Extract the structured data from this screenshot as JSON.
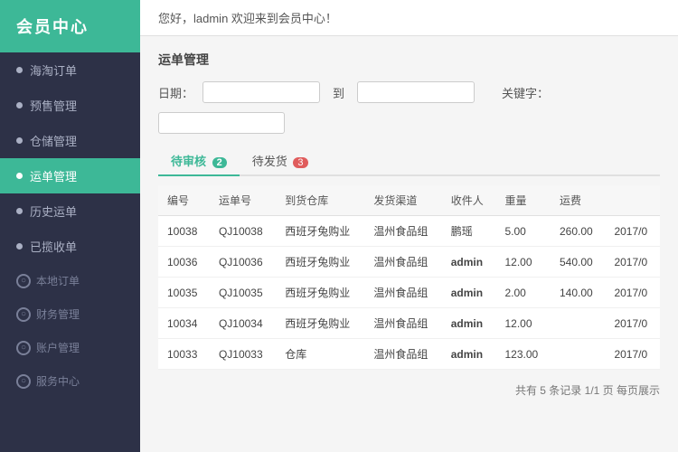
{
  "sidebar": {
    "logo": "会员中心",
    "items": [
      {
        "id": "haiwai-order",
        "label": "海淘订单",
        "active": false,
        "group": false
      },
      {
        "id": "yunshu",
        "label": "预售管理",
        "active": false,
        "group": false
      },
      {
        "id": "cangku",
        "label": "仓储管理",
        "active": false,
        "group": false
      },
      {
        "id": "yundan",
        "label": "运单管理",
        "active": true,
        "group": false
      },
      {
        "id": "lidanorder",
        "label": "历史运单",
        "active": false,
        "group": false
      },
      {
        "id": "yijiu",
        "label": "已揽收单",
        "active": false,
        "group": false
      },
      {
        "id": "bendi-order",
        "label": "本地订单",
        "active": false,
        "group": true,
        "groupLabel": "本地订单"
      },
      {
        "id": "caiwu",
        "label": "财务管理",
        "active": false,
        "group": true,
        "groupLabel": "财务管理"
      },
      {
        "id": "zhanghu",
        "label": "账户管理",
        "active": false,
        "group": true,
        "groupLabel": "账户管理"
      },
      {
        "id": "fuwu",
        "label": "服务中心",
        "active": false,
        "group": true,
        "groupLabel": "服务中心"
      }
    ]
  },
  "topbar": {
    "greeting": "您好，ladmin 欢迎来到会员中心！"
  },
  "content": {
    "section_title": "运单管理",
    "filter": {
      "date_label": "日期：",
      "date_from": "",
      "date_to_label": "到",
      "date_to": "",
      "keyword_label": "关键字：",
      "keyword_value": ""
    },
    "tabs": [
      {
        "id": "tab-pending",
        "label": "待审核",
        "count": "2",
        "active": true,
        "color": "green"
      },
      {
        "id": "tab-sending",
        "label": "待发货",
        "count": "3",
        "active": false,
        "color": "red"
      }
    ],
    "table": {
      "headers": [
        "编号",
        "运单号",
        "到货仓库",
        "发货渠道",
        "收件人",
        "重量",
        "运费",
        ""
      ],
      "rows": [
        {
          "id": "10038",
          "waybill": "QJ10038",
          "warehouse": "西班牙兔购业",
          "channel": "温州食品组",
          "receiver": "鹏瑶",
          "weight": "5.00",
          "freight": "260.00",
          "date": "2017/0"
        },
        {
          "id": "10036",
          "waybill": "QJ10036",
          "warehouse": "西班牙兔购业",
          "channel": "温州食品组",
          "receiver": "admin",
          "weight": "12.00",
          "freight": "540.00",
          "date": "2017/0"
        },
        {
          "id": "10035",
          "waybill": "QJ10035",
          "warehouse": "西班牙兔购业",
          "channel": "温州食品组",
          "receiver": "admin",
          "weight": "2.00",
          "freight": "140.00",
          "date": "2017/0"
        },
        {
          "id": "10034",
          "waybill": "QJ10034",
          "warehouse": "西班牙兔购业",
          "channel": "温州食品组",
          "receiver": "admin",
          "weight": "12.00",
          "freight": "",
          "date": "2017/0"
        },
        {
          "id": "10033",
          "waybill": "QJ10033",
          "warehouse": "仓库",
          "channel": "温州食品组",
          "receiver": "admin",
          "weight": "123.00",
          "freight": "",
          "date": "2017/0"
        }
      ]
    },
    "pagination": "共有 5 条记录  1/1 页  每页展示"
  }
}
